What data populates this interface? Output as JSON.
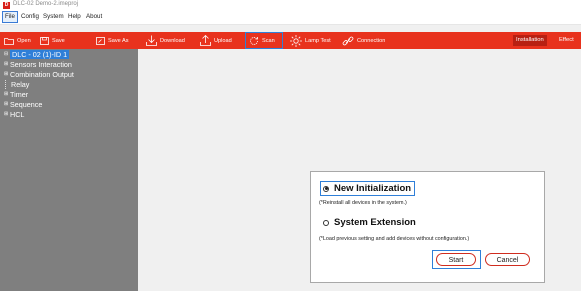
{
  "window": {
    "title": "DLC-02   Demo-2.imeproj"
  },
  "menu": {
    "items": [
      "File",
      "Config",
      "System",
      "Help",
      "About"
    ]
  },
  "toolbar": {
    "open": "Open",
    "save": "Save",
    "save_as": "Save As",
    "download": "Download",
    "upload": "Upload",
    "scan": "Scan",
    "lamp_test": "Lamp Test",
    "connection": "Connection",
    "installation": "Installation",
    "effect": "Effect"
  },
  "tree": {
    "items": [
      {
        "label": "DLC - 02 (1)-ID 1",
        "expander": "⊟"
      },
      {
        "label": "Sensors Interaction",
        "expander": "⊞"
      },
      {
        "label": "Combination Output",
        "expander": "⊞"
      },
      {
        "label": "Relay",
        "expander": ""
      },
      {
        "label": "Timer",
        "expander": "⊞"
      },
      {
        "label": "Sequence",
        "expander": "⊞"
      },
      {
        "label": "HCL",
        "expander": "⊞"
      }
    ]
  },
  "dialog": {
    "option1_label": "New Initialization",
    "option1_note": "(*Reinstall all devices in the system.)",
    "option2_label": "System Extension",
    "option2_note": "(*Load previous setting and add devices without configuration.)",
    "start": "Start",
    "cancel": "Cancel",
    "selected": "New Initialization"
  },
  "colors": {
    "toolbar_bg": "#e8321d",
    "sidebar_bg": "#7f7f7f",
    "highlight_blue": "#2f7fd8",
    "button_border_red": "#d02c1e"
  },
  "icons": {
    "open": "folder-icon",
    "save": "save-icon",
    "save_as": "save-as-icon",
    "download": "download-icon",
    "upload": "upload-icon",
    "scan": "scan-icon",
    "lamp_test": "lamp-icon",
    "connection": "link-icon"
  }
}
